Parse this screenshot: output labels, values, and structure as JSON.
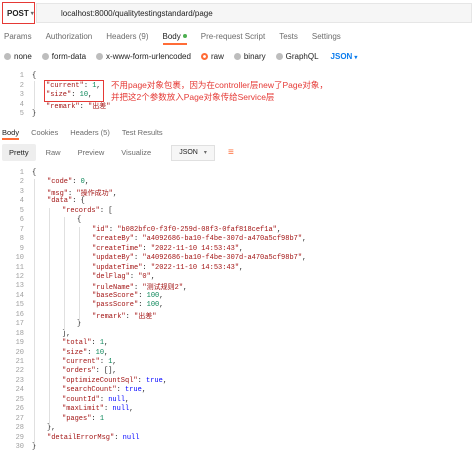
{
  "request": {
    "method": "POST",
    "url": "localhost:8000/qualitytestingstandard/page"
  },
  "request_tabs": [
    {
      "label": "Params",
      "active": false
    },
    {
      "label": "Authorization",
      "active": false
    },
    {
      "label": "Headers (9)",
      "active": false
    },
    {
      "label": "Body",
      "active": true
    },
    {
      "label": "Pre-request Script",
      "active": false
    },
    {
      "label": "Tests",
      "active": false
    },
    {
      "label": "Settings",
      "active": false
    }
  ],
  "body_options": [
    {
      "label": "none",
      "selected": false
    },
    {
      "label": "form-data",
      "selected": false
    },
    {
      "label": "x-www-form-urlencoded",
      "selected": false
    },
    {
      "label": "raw",
      "selected": true
    },
    {
      "label": "binary",
      "selected": false
    },
    {
      "label": "GraphQL",
      "selected": false
    }
  ],
  "body_format": "JSON",
  "request_body_lines": [
    {
      "num": "1",
      "text": "{"
    },
    {
      "num": "2",
      "key": "\"current\"",
      "value": "1",
      "vtype": "n"
    },
    {
      "num": "3",
      "key": "\"size\"",
      "value": "10",
      "vtype": "n"
    },
    {
      "num": "4",
      "key": "\"remark\"",
      "value": "\"出差\"",
      "vtype": "s",
      "last": true
    },
    {
      "num": "5",
      "text": "}"
    }
  ],
  "annotation": {
    "line1": "不用page对象包裹，因为在controller层new了Page对象，",
    "line2": "并把这2个参数放入Page对象传给Service层"
  },
  "response_tabs": [
    {
      "label": "Body",
      "active": true
    },
    {
      "label": "Cookies",
      "active": false
    },
    {
      "label": "Headers (5)",
      "active": false
    },
    {
      "label": "Test Results",
      "active": false
    }
  ],
  "view_modes": [
    {
      "label": "Pretty",
      "active": true
    },
    {
      "label": "Raw",
      "active": false
    },
    {
      "label": "Preview",
      "active": false
    },
    {
      "label": "Visualize",
      "active": false
    }
  ],
  "response_format": "JSON",
  "response_lines": [
    {
      "num": "1",
      "indent": 0,
      "text": "{"
    },
    {
      "num": "2",
      "indent": 1,
      "key": "\"code\"",
      "value": "0",
      "vtype": "n"
    },
    {
      "num": "3",
      "indent": 1,
      "key": "\"msg\"",
      "value": "\"操作成功\"",
      "vtype": "s"
    },
    {
      "num": "4",
      "indent": 1,
      "key": "\"data\"",
      "open": "{"
    },
    {
      "num": "5",
      "indent": 2,
      "key": "\"records\"",
      "open": "["
    },
    {
      "num": "6",
      "indent": 3,
      "text": "{"
    },
    {
      "num": "7",
      "indent": 4,
      "key": "\"id\"",
      "value": "\"b082bfc0-f3f0-259d-08f3-0faf818cef1a\"",
      "vtype": "s"
    },
    {
      "num": "8",
      "indent": 4,
      "key": "\"createBy\"",
      "value": "\"a4092686-ba10-f4be-307d-a470a5cf98b7\"",
      "vtype": "s"
    },
    {
      "num": "9",
      "indent": 4,
      "key": "\"createTime\"",
      "value": "\"2022-11-10 14:53:43\"",
      "vtype": "s"
    },
    {
      "num": "10",
      "indent": 4,
      "key": "\"updateBy\"",
      "value": "\"a4092686-ba10-f4be-307d-a470a5cf98b7\"",
      "vtype": "s"
    },
    {
      "num": "11",
      "indent": 4,
      "key": "\"updateTime\"",
      "value": "\"2022-11-10 14:53:43\"",
      "vtype": "s"
    },
    {
      "num": "12",
      "indent": 4,
      "key": "\"delFlag\"",
      "value": "\"0\"",
      "vtype": "s"
    },
    {
      "num": "13",
      "indent": 4,
      "key": "\"ruleName\"",
      "value": "\"测试规则2\"",
      "vtype": "s"
    },
    {
      "num": "14",
      "indent": 4,
      "key": "\"baseScore\"",
      "value": "100",
      "vtype": "n"
    },
    {
      "num": "15",
      "indent": 4,
      "key": "\"passScore\"",
      "value": "100",
      "vtype": "n"
    },
    {
      "num": "16",
      "indent": 4,
      "key": "\"remark\"",
      "value": "\"出差\"",
      "vtype": "s",
      "last": true
    },
    {
      "num": "17",
      "indent": 3,
      "text": "}"
    },
    {
      "num": "18",
      "indent": 2,
      "text": "],"
    },
    {
      "num": "19",
      "indent": 2,
      "key": "\"total\"",
      "value": "1",
      "vtype": "n"
    },
    {
      "num": "20",
      "indent": 2,
      "key": "\"size\"",
      "value": "10",
      "vtype": "n"
    },
    {
      "num": "21",
      "indent": 2,
      "key": "\"current\"",
      "value": "1",
      "vtype": "n"
    },
    {
      "num": "22",
      "indent": 2,
      "key": "\"orders\"",
      "value": "[]",
      "vtype": "p"
    },
    {
      "num": "23",
      "indent": 2,
      "key": "\"optimizeCountSql\"",
      "value": "true",
      "vtype": "b"
    },
    {
      "num": "24",
      "indent": 2,
      "key": "\"searchCount\"",
      "value": "true",
      "vtype": "b"
    },
    {
      "num": "25",
      "indent": 2,
      "key": "\"countId\"",
      "value": "null",
      "vtype": "b"
    },
    {
      "num": "26",
      "indent": 2,
      "key": "\"maxLimit\"",
      "value": "null",
      "vtype": "b"
    },
    {
      "num": "27",
      "indent": 2,
      "key": "\"pages\"",
      "value": "1",
      "vtype": "n",
      "last": true
    },
    {
      "num": "28",
      "indent": 1,
      "text": "},"
    },
    {
      "num": "29",
      "indent": 1,
      "key": "\"detailErrorMsg\"",
      "value": "null",
      "vtype": "b",
      "last": true
    },
    {
      "num": "30",
      "indent": 0,
      "text": "}"
    }
  ],
  "colors": {
    "accent": "#ff6c37",
    "highlight": "#e53935",
    "json_key": "#a31515",
    "json_number": "#098658",
    "json_literal": "#0000ff"
  }
}
